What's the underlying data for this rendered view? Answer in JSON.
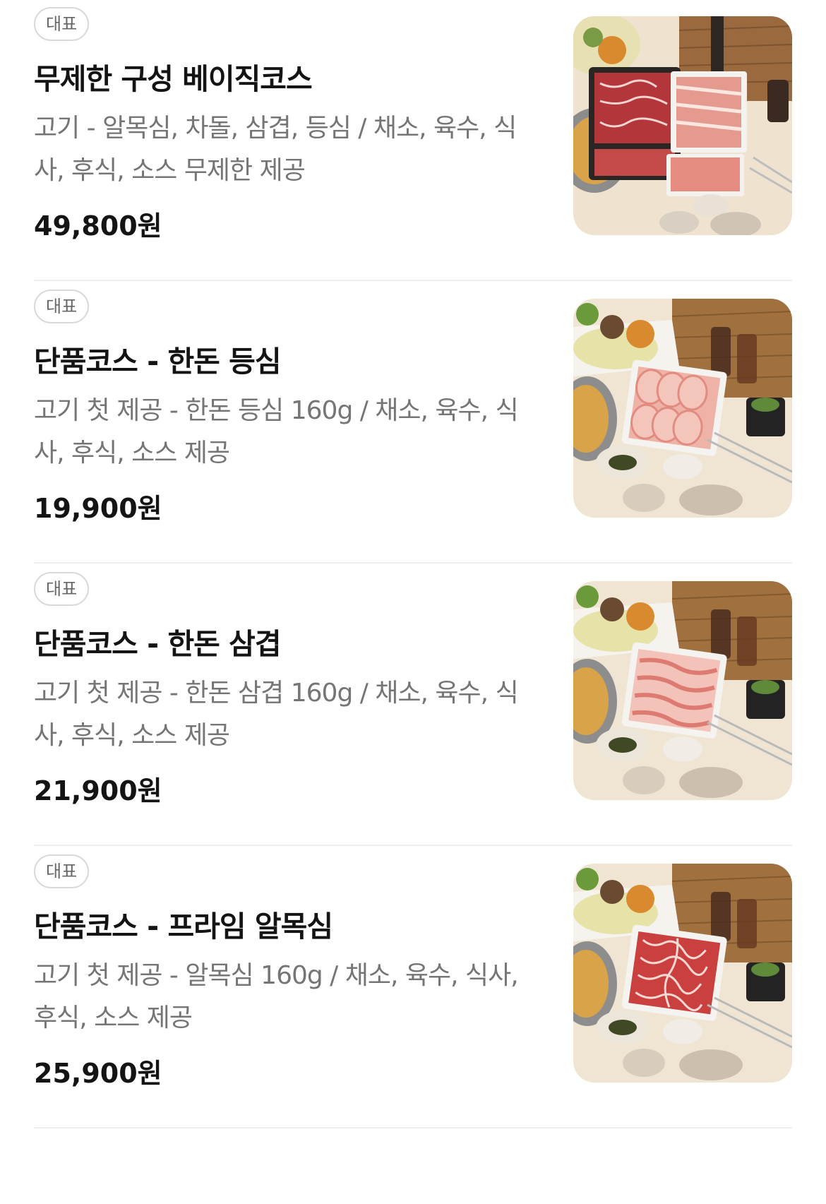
{
  "menu": {
    "items": [
      {
        "badge": "대표",
        "title": "무제한 구성 베이직코스",
        "description": "고기 - 알목심, 차돌, 삼겹, 등심 / 채소, 육수, 식사, 후식, 소스 무제한 제공",
        "price": "49,800원",
        "image": "hotpot-unlimited-platter",
        "meat_color": "#b83a3a"
      },
      {
        "badge": "대표",
        "title": "단품코스 - 한돈 등심",
        "description": "고기 첫 제공 - 한돈 등심 160g / 채소, 육수, 식사, 후식, 소스 제공",
        "price": "19,900원",
        "image": "hotpot-pork-loin",
        "meat_color": "#e9a29a"
      },
      {
        "badge": "대표",
        "title": "단품코스 - 한돈 삼겹",
        "description": "고기 첫 제공 - 한돈 삼겹 160g / 채소, 육수, 식사, 후식, 소스 제공",
        "price": "21,900원",
        "image": "hotpot-pork-belly",
        "meat_color": "#e58f8a"
      },
      {
        "badge": "대표",
        "title": "단품코스 - 프라임 알목심",
        "description": "고기 첫 제공 - 알목심 160g / 채소, 육수, 식사, 후식, 소스 제공",
        "price": "25,900원",
        "image": "hotpot-prime-chuck",
        "meat_color": "#c8403f"
      }
    ]
  }
}
